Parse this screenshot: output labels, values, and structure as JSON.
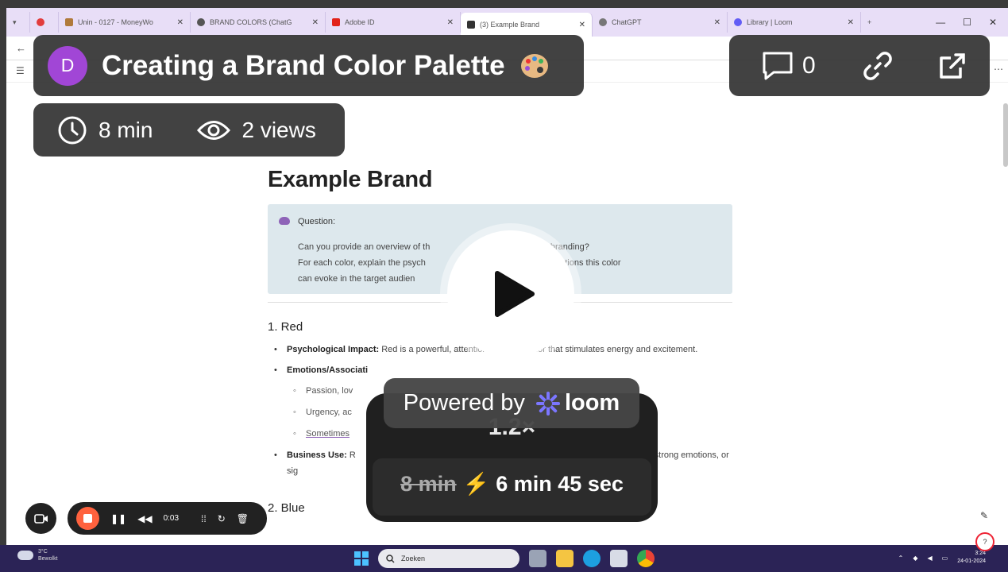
{
  "browser": {
    "tabs": [
      {
        "label": "",
        "favicon_color": "#e23d3d"
      },
      {
        "label": "Unin - 0127 - MoneyWo",
        "favicon_color": "#b07a3b"
      },
      {
        "label": "BRAND COLORS (ChatG",
        "favicon_color": "#555555"
      },
      {
        "label": "Adobe ID",
        "favicon_color": "#e2231a"
      },
      {
        "label": "(3) Example Brand",
        "favicon_color": "#333333"
      },
      {
        "label": "ChatGPT",
        "favicon_color": "#777777"
      },
      {
        "label": "Library | Loom",
        "favicon_color": "#625df5"
      }
    ],
    "new_tab": "+",
    "window_controls": {
      "minimize": "—",
      "maximize": "☐",
      "close": "✕"
    }
  },
  "document": {
    "title": "Example Brand",
    "callout": {
      "label": "Question:",
      "text": "Can you provide an overview of th                 in business branding?\nFor each color, explain the psych               rmations or associations this color\ncan evoke in the target audien"
    },
    "section_red": {
      "heading": "1. Red",
      "impact_label": "Psychological Impact:",
      "impact_text": " Red is a powerful, attention-grabbing color that stimulates energy and excitement.",
      "emotions_label": "Emotions/Associati",
      "emotions_items": [
        "Passion, lov",
        "Urgency, ac",
        "Sometimes"
      ],
      "business_label": "Business Use:",
      "business_text": " R                                                                voke strong emotions, or sig"
    },
    "section_blue": {
      "heading": "2. Blue"
    }
  },
  "loom": {
    "avatar_letter": "D",
    "video_title": "Creating a Brand Color Palette",
    "duration": "8 min",
    "views": "2 views",
    "comment_count": "0",
    "powered_by": "Powered by",
    "brand": "loom",
    "speed": "1.2×",
    "speed_old": "8 min",
    "speed_new": "6 min 45 sec"
  },
  "recorder": {
    "elapsed": "0:03"
  },
  "taskbar": {
    "weather_temp": "3°C",
    "weather_text": "Bewolkt",
    "search_placeholder": "Zoeken",
    "time": "3:24",
    "date": "24-01-2024"
  },
  "colors": {
    "tabstrip": "#e8def7",
    "callout_bg": "#dde8ed",
    "loom_overlay": "#323232",
    "avatar": "#a146d6",
    "stop_button": "#ff623e",
    "taskbar": "#2b2356",
    "loom_brand": "#625df5"
  }
}
